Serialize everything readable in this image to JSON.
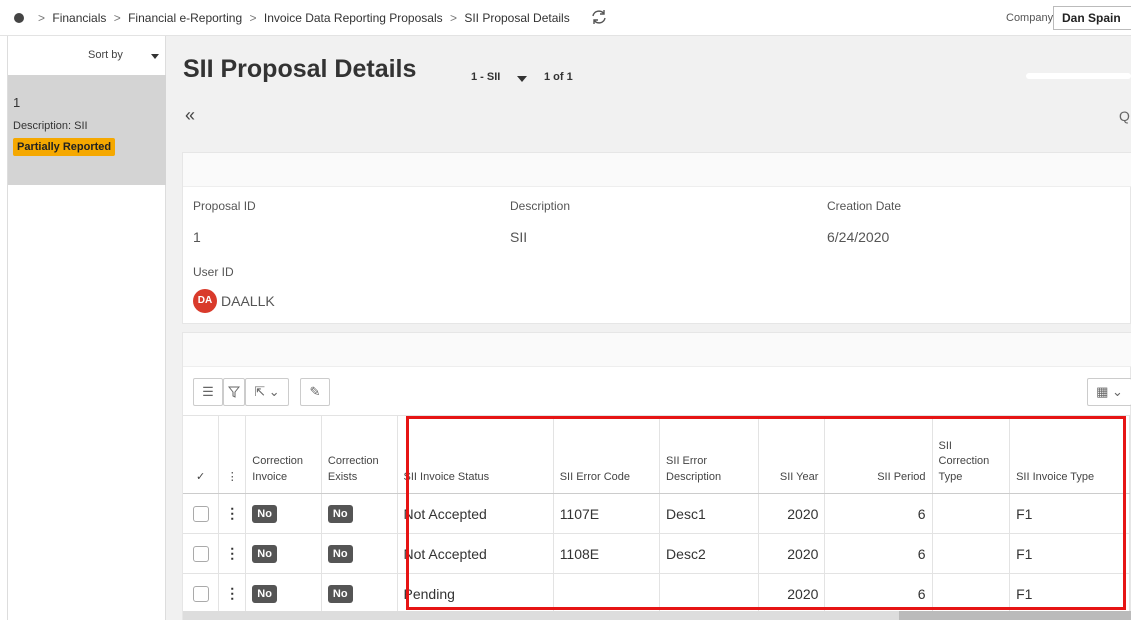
{
  "breadcrumb": [
    "Financials",
    "Financial e-Reporting",
    "Invoice Data Reporting Proposals",
    "SII Proposal Details"
  ],
  "company": {
    "label": "Company",
    "value": "Dan Spain"
  },
  "left_panel": {
    "sort_label": "Sort by",
    "record": {
      "id": "1",
      "description": "Description:  SII",
      "status": "Partially Reported"
    }
  },
  "header": {
    "title": "SII Proposal Details",
    "selector": "1 - SII",
    "count": "1 of 1"
  },
  "details": {
    "proposal_id": {
      "label": "Proposal ID",
      "value": "1"
    },
    "description": {
      "label": "Description",
      "value": "SII"
    },
    "creation_date": {
      "label": "Creation Date",
      "value": "6/24/2020"
    },
    "user_id": {
      "label": "User ID",
      "initials": "DA",
      "value": "DAALLK"
    }
  },
  "table": {
    "columns": {
      "correction_invoice": "Correction Invoice",
      "correction_exists": "Correction Exists",
      "sii_invoice_status": "SII Invoice Status",
      "sii_error_code": "SII Error Code",
      "sii_error_description": "SII Error Description",
      "sii_year": "SII Year",
      "sii_period": "SII Period",
      "sii_correction_type": "SII Correction Type",
      "sii_invoice_type": "SII Invoice Type"
    },
    "rows": [
      {
        "correction_invoice": "No",
        "correction_exists": "No",
        "status": "Not Accepted",
        "error_code": "1107E",
        "error_desc": "Desc1",
        "year": "2020",
        "period": "6",
        "correction_type": "",
        "invoice_type": "F1"
      },
      {
        "correction_invoice": "No",
        "correction_exists": "No",
        "status": "Not Accepted",
        "error_code": "1108E",
        "error_desc": "Desc2",
        "year": "2020",
        "period": "6",
        "correction_type": "",
        "invoice_type": "F1"
      },
      {
        "correction_invoice": "No",
        "correction_exists": "No",
        "status": "Pending",
        "error_code": "",
        "error_desc": "",
        "year": "2020",
        "period": "6",
        "correction_type": "",
        "invoice_type": "F1"
      }
    ]
  },
  "icons": {
    "refresh": "refresh-icon",
    "collapse": "double-chevron-left-icon",
    "list": "list-icon",
    "filter": "filter-icon",
    "export": "export-icon",
    "edit": "pencil-icon",
    "columns": "table-columns-icon"
  },
  "colors": {
    "badge_partial": "#f5a800",
    "no_badge": "#555555",
    "avatar": "#d93a2b",
    "highlight": "#e61414"
  }
}
